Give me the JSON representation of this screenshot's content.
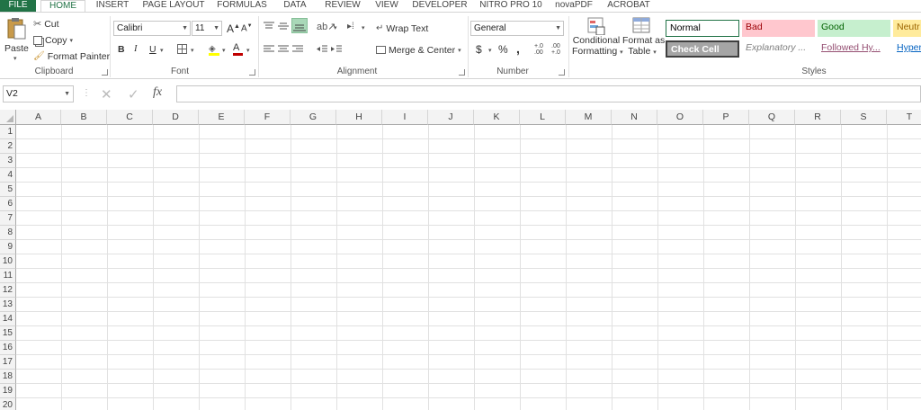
{
  "tabs": [
    "FILE",
    "HOME",
    "INSERT",
    "PAGE LAYOUT",
    "FORMULAS",
    "DATA",
    "REVIEW",
    "VIEW",
    "DEVELOPER",
    "NITRO PRO 10",
    "novaPDF",
    "ACROBAT"
  ],
  "clipboard": {
    "paste": "Paste",
    "cut": "Cut",
    "copy": "Copy",
    "format_painter": "Format Painter",
    "label": "Clipboard"
  },
  "font": {
    "name": "Calibri",
    "size": "11",
    "bold": "B",
    "italic": "I",
    "underline": "U",
    "grow": "A",
    "shrink": "A",
    "font_color": "A",
    "label": "Font"
  },
  "alignment": {
    "wrap_text": "Wrap Text",
    "merge_center": "Merge & Center",
    "label": "Alignment"
  },
  "number": {
    "format": "General",
    "currency": "$",
    "percent": "%",
    "comma": ",",
    "increase_decimal": "+.0 .00",
    "decrease_decimal": ".00 +.0",
    "label": "Number"
  },
  "styles": {
    "conditional_formatting": [
      "Conditional",
      "Formatting"
    ],
    "format_as_table": [
      "Format as",
      "Table"
    ],
    "cells": [
      {
        "name": "Normal",
        "bg": "#ffffff",
        "color": "#000000",
        "border": "#217346"
      },
      {
        "name": "Bad",
        "bg": "#ffc7ce",
        "color": "#9c0006"
      },
      {
        "name": "Good",
        "bg": "#c6efce",
        "color": "#006100"
      },
      {
        "name": "Neutr",
        "bg": "#ffeb9c",
        "color": "#9c6500"
      },
      {
        "name": "Check Cell",
        "bg": "#a5a5a5",
        "color": "#ffffff",
        "border": "#3f3f3f"
      },
      {
        "name": "Explanatory ...",
        "bg": "#ffffff",
        "color": "#7f7f7f"
      },
      {
        "name": "Followed Hy...",
        "bg": "#ffffff",
        "color": "#954f72"
      },
      {
        "name": "Hyper",
        "bg": "#ffffff",
        "color": "#0563c1"
      }
    ],
    "label": "Styles"
  },
  "formula_bar": {
    "name_box": "V2",
    "fx": "fx",
    "value": ""
  },
  "columns": [
    "A",
    "B",
    "C",
    "D",
    "E",
    "F",
    "G",
    "H",
    "I",
    "J",
    "K",
    "L",
    "M",
    "N",
    "O",
    "P",
    "Q",
    "R",
    "S",
    "T"
  ],
  "rows": [
    "1",
    "2",
    "3",
    "4",
    "5",
    "6",
    "7",
    "8",
    "9",
    "10",
    "11",
    "12",
    "13",
    "14",
    "15",
    "16",
    "17",
    "18",
    "19",
    "20"
  ],
  "colors": {
    "accent": "#217346"
  }
}
